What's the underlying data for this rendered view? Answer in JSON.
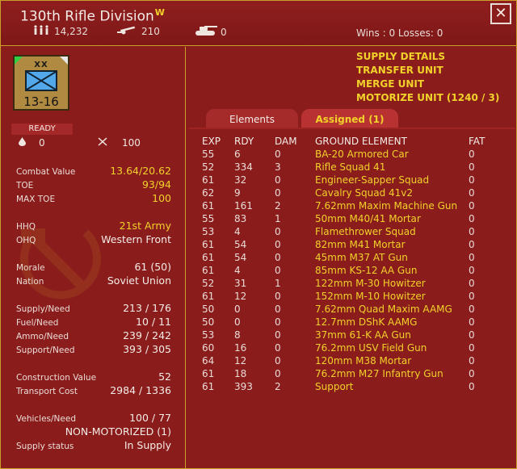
{
  "header": {
    "title": "130th Rifle Division",
    "title_badge": "W",
    "men": "14,232",
    "guns": "210",
    "tanks": "0",
    "record": "Wins : 0  Losses: 0",
    "close_label": "✕"
  },
  "unit": {
    "size_mark": "XX",
    "counter_value": "13-16",
    "status": "READY",
    "fuel_small": "0",
    "morale_small": "100"
  },
  "stats": {
    "combat_value": {
      "label": "Combat Value",
      "value": "13.64/20.62"
    },
    "toe": {
      "label": "TOE",
      "value": "93/94"
    },
    "max_toe": {
      "label": "MAX TOE",
      "value": "100"
    },
    "hhq": {
      "label": "HHQ",
      "value": "21st Army"
    },
    "ohq": {
      "label": "OHQ",
      "value": "Western Front"
    },
    "morale": {
      "label": "Morale",
      "value": "61 (50)"
    },
    "nation": {
      "label": "Nation",
      "value": "Soviet Union"
    },
    "supply": {
      "label": "Supply/Need",
      "value": "213 / 176"
    },
    "fuel": {
      "label": "Fuel/Need",
      "value": "10 / 11"
    },
    "ammo": {
      "label": "Ammo/Need",
      "value": "239 / 242"
    },
    "support": {
      "label": "Support/Need",
      "value": "393 / 305"
    },
    "construction": {
      "label": "Construction Value",
      "value": "52"
    },
    "transport": {
      "label": "Transport Cost",
      "value": "2984 / 1336"
    },
    "vehicles": {
      "label": "Vehicles/Need",
      "value": "100 / 77"
    },
    "motorization": "NON-MOTORIZED (1)",
    "supply_status": {
      "label": "Supply status",
      "value": "In Supply"
    }
  },
  "actions": {
    "supply_details": "SUPPLY DETAILS",
    "transfer": "TRANSFER UNIT",
    "merge": "MERGE UNIT",
    "motorize": "MOTORIZE UNIT (1240 / 3)"
  },
  "tabs": {
    "elements": "Elements",
    "assigned": "Assigned (1)"
  },
  "table": {
    "headers": {
      "exp": "EXP",
      "rdy": "RDY",
      "dam": "DAM",
      "name": "GROUND ELEMENT",
      "fat": "FAT"
    },
    "rows": [
      {
        "exp": "55",
        "rdy": "6",
        "dam": "0",
        "name": "BA-20 Armored Car",
        "fat": "0"
      },
      {
        "exp": "52",
        "rdy": "334",
        "dam": "3",
        "name": "Rifle Squad 41",
        "fat": "0"
      },
      {
        "exp": "61",
        "rdy": "32",
        "dam": "0",
        "name": "Engineer-Sapper Squad",
        "fat": "0"
      },
      {
        "exp": "62",
        "rdy": "9",
        "dam": "0",
        "name": "Cavalry Squad 41v2",
        "fat": "0"
      },
      {
        "exp": "61",
        "rdy": "161",
        "dam": "2",
        "name": "7.62mm Maxim Machine Gun",
        "fat": "0"
      },
      {
        "exp": "55",
        "rdy": "83",
        "dam": "1",
        "name": "50mm M40/41 Mortar",
        "fat": "0"
      },
      {
        "exp": "53",
        "rdy": "4",
        "dam": "0",
        "name": "Flamethrower Squad",
        "fat": "0"
      },
      {
        "exp": "61",
        "rdy": "54",
        "dam": "0",
        "name": "82mm M41 Mortar",
        "fat": "0"
      },
      {
        "exp": "61",
        "rdy": "54",
        "dam": "0",
        "name": "45mm M37 AT Gun",
        "fat": "0"
      },
      {
        "exp": "61",
        "rdy": "4",
        "dam": "0",
        "name": "85mm KS-12 AA Gun",
        "fat": "0"
      },
      {
        "exp": "52",
        "rdy": "31",
        "dam": "1",
        "name": "122mm M-30 Howitzer",
        "fat": "0"
      },
      {
        "exp": "61",
        "rdy": "12",
        "dam": "0",
        "name": "152mm M-10 Howitzer",
        "fat": "0"
      },
      {
        "exp": "50",
        "rdy": "0",
        "dam": "0",
        "name": "7.62mm Quad Maxim AAMG",
        "fat": "0"
      },
      {
        "exp": "50",
        "rdy": "0",
        "dam": "0",
        "name": "12.7mm DShK AAMG",
        "fat": "0"
      },
      {
        "exp": "53",
        "rdy": "8",
        "dam": "0",
        "name": "37mm 61-K AA Gun",
        "fat": "0"
      },
      {
        "exp": "60",
        "rdy": "16",
        "dam": "0",
        "name": "76.2mm USV Field Gun",
        "fat": "0"
      },
      {
        "exp": "64",
        "rdy": "12",
        "dam": "0",
        "name": "120mm M38 Mortar",
        "fat": "0"
      },
      {
        "exp": "61",
        "rdy": "18",
        "dam": "0",
        "name": "76.2mm M27 Infantry Gun",
        "fat": "0"
      },
      {
        "exp": "61",
        "rdy": "393",
        "dam": "2",
        "name": "Support",
        "fat": "0"
      }
    ]
  }
}
